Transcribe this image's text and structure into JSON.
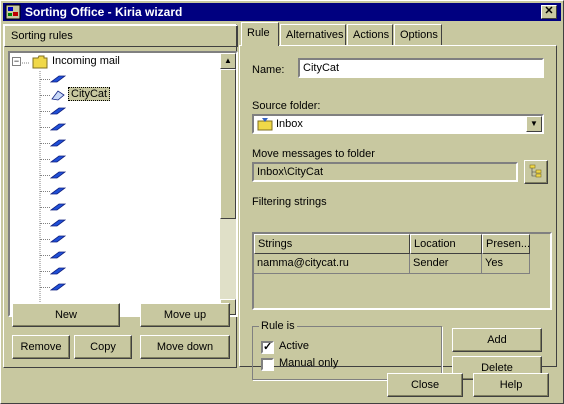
{
  "window": {
    "title": "Sorting Office - Kiria wizard",
    "close_glyph": "✕"
  },
  "left": {
    "header": "Sorting rules",
    "tree": {
      "root_label": "Incoming mail",
      "selected_label": "CityCat",
      "rule_count_visible": 14
    },
    "buttons": {
      "new": "New",
      "move_up": "Move up",
      "remove": "Remove",
      "copy": "Copy",
      "move_down": "Move down"
    }
  },
  "tabs": [
    "Rule",
    "Alternatives",
    "Actions",
    "Options"
  ],
  "rule": {
    "name_label": "Name:",
    "name_value": "CityCat",
    "source_label": "Source folder:",
    "source_value": "Inbox",
    "move_label": "Move messages to folder",
    "move_value": "Inbox\\CityCat",
    "filter_label": "Filtering strings",
    "grid": {
      "headers": [
        "Strings",
        "Location",
        "Presen..."
      ],
      "rows": [
        [
          "namma@citycat.ru",
          "Sender",
          "Yes"
        ]
      ]
    },
    "rule_is_label": "Rule is",
    "active_label": "Active",
    "active_checked": true,
    "manual_label": "Manual only",
    "manual_checked": false,
    "add_label": "Add",
    "delete_label": "Delete"
  },
  "footer": {
    "close_label": "Close",
    "help_label": "Help"
  }
}
